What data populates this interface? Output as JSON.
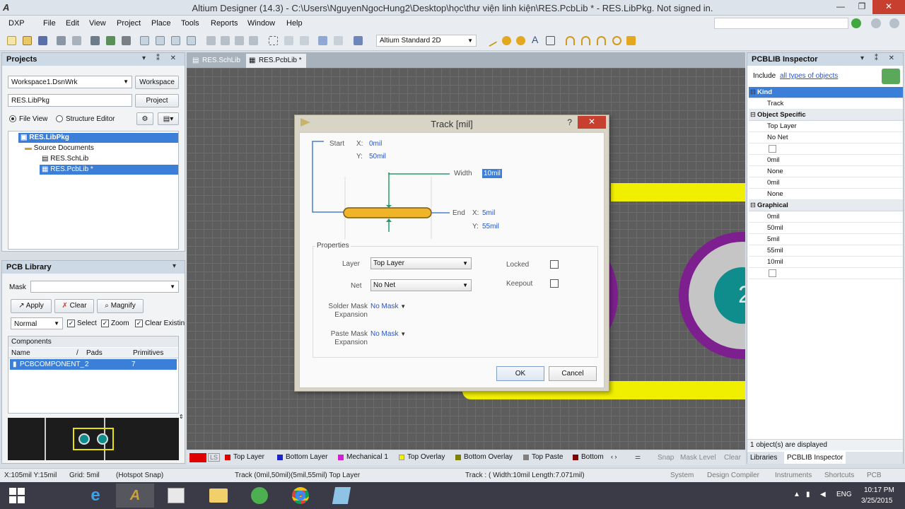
{
  "window": {
    "title": "Altium Designer (14.3) - C:\\Users\\NguyenNgocHung2\\Desktop\\học\\thư viện linh kiện\\RES.PcbLib * - RES.LibPkg. Not signed in.",
    "app_letter": "A"
  },
  "menu": [
    "DXP",
    "File",
    "Edit",
    "View",
    "Project",
    "Place",
    "Tools",
    "Reports",
    "Window",
    "Help"
  ],
  "toolbar": {
    "view_mode": "Altium Standard 2D"
  },
  "projects_panel": {
    "title": "Projects",
    "workspace_value": "Workspace1.DsnWrk",
    "workspace_button": "Workspace",
    "project_value": "RES.LibPkg",
    "project_button": "Project",
    "file_view": "File View",
    "structure_editor": "Structure Editor",
    "tree": {
      "root": "RES.LibPkg",
      "folder": "Source Documents",
      "items": [
        "RES.SchLib",
        "RES.PcbLib *"
      ]
    }
  },
  "pcb_library_panel": {
    "title": "PCB Library",
    "mask_label": "Mask",
    "apply": "Apply",
    "clear": "Clear",
    "magnify": "Magnify",
    "mode": "Normal",
    "select": "Select",
    "zoom": "Zoom",
    "clear_existing": "Clear Existin",
    "components_label": "Components",
    "columns": [
      "Name",
      "/",
      "Pads",
      "Primitives"
    ],
    "rows": [
      {
        "name": "PCBCOMPONENT_",
        "pads": "2",
        "primitives": "7"
      }
    ]
  },
  "doc_tabs": [
    "RES.SchLib",
    "RES.PcbLib *"
  ],
  "dialog": {
    "title": "Track [mil]",
    "help": "?",
    "close": "✕",
    "start_label": "Start",
    "start_x_label": "X:",
    "start_x": "0mil",
    "start_y_label": "Y:",
    "start_y": "50mil",
    "width_label": "Width",
    "width": "10mil",
    "end_label": "End",
    "end_x_label": "X:",
    "end_x": "5mil",
    "end_y_label": "Y:",
    "end_y": "55mil",
    "properties_label": "Properties",
    "layer_label": "Layer",
    "layer_value": "Top Layer",
    "net_label": "Net",
    "net_value": "No Net",
    "locked_label": "Locked",
    "keepout_label": "Keepout",
    "solder_mask_label": "Solder Mask\nExpansion",
    "solder_mask_value": "No Mask",
    "paste_mask_label": "Paste Mask\nExpansion",
    "paste_mask_value": "No Mask",
    "ok": "OK",
    "cancel": "Cancel"
  },
  "inspector": {
    "title": "PCBLIB Inspector",
    "include_label": "Include",
    "include_link": "all types of objects",
    "groups": [
      {
        "name": "Kind",
        "rows": [
          "Track"
        ]
      },
      {
        "name": "Object Specific",
        "rows": [
          "Top Layer",
          "No Net",
          "",
          "0mil",
          "None",
          "0mil",
          "None"
        ]
      },
      {
        "name": "Graphical",
        "rows": [
          "0mil",
          "50mil",
          "5mil",
          "55mil",
          "10mil",
          ""
        ]
      }
    ],
    "footer": "1 object(s) are displayed",
    "tabs": [
      "Libraries",
      "PCBLIB Inspector"
    ]
  },
  "layers": [
    {
      "name": "Top Layer",
      "color": "#e00000"
    },
    {
      "name": "Bottom Layer",
      "color": "#1b23c9"
    },
    {
      "name": "Mechanical 1",
      "color": "#d21fd2"
    },
    {
      "name": "Top Overlay",
      "color": "#f0f000"
    },
    {
      "name": "Bottom Overlay",
      "color": "#7f7f00"
    },
    {
      "name": "Top Paste",
      "color": "#808080"
    },
    {
      "name": "Bottom",
      "color": "#800000"
    }
  ],
  "layer_bar_right": [
    "Snap",
    "Mask Level",
    "Clear"
  ],
  "ls_label": "LS",
  "status": {
    "coords": "X:105mil Y:15mil",
    "grid": "Grid: 5mil",
    "snap": "(Hotspot Snap)",
    "track": "Track (0mil,50mil)(5mil,55mil) Top Layer",
    "track_info": "Track : ( Width:10mil Length:7.071mil)",
    "right": [
      "System",
      "Design Compiler",
      "Instruments",
      "Shortcuts",
      "PCB"
    ]
  },
  "taskbar": {
    "lang": "ENG",
    "time": "10:17 PM",
    "date": "3/25/2015"
  },
  "pad_label": "2",
  "colors": {
    "selection": "#3b7fd8",
    "close": "#c7402f",
    "track": "#f0b429",
    "purple": "#7e1f8f",
    "teal": "#0f8c8c",
    "yellow": "#f1ef00"
  }
}
